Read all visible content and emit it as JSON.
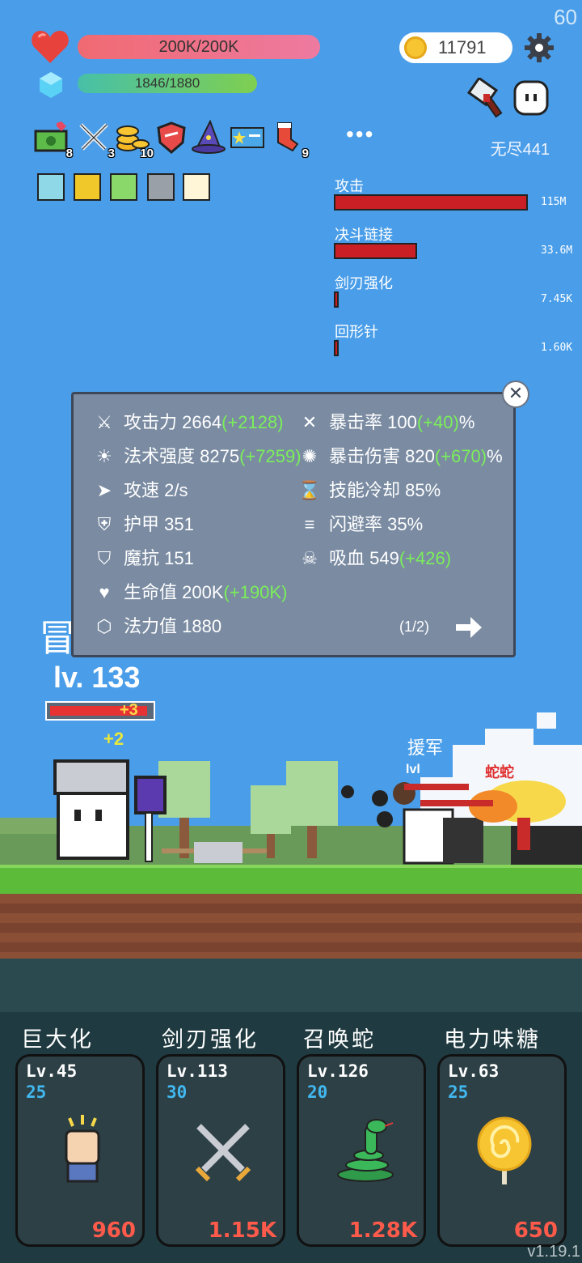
{
  "fps": "60",
  "hp": {
    "text": "200K/200K"
  },
  "mp": {
    "text": "1846/1880",
    "fraction": 0.982
  },
  "coins": "11791",
  "endless": "无尽441",
  "items": [
    {
      "name": "money",
      "count": "8"
    },
    {
      "name": "swords",
      "count": "3"
    },
    {
      "name": "coins",
      "count": "10"
    },
    {
      "name": "shield",
      "count": ""
    },
    {
      "name": "wizard-hat",
      "count": ""
    },
    {
      "name": "card",
      "count": ""
    },
    {
      "name": "sock",
      "count": "9"
    }
  ],
  "more": "•••",
  "buffs": [
    "bulb",
    "monster",
    "check",
    "blade",
    "burst"
  ],
  "damage": [
    {
      "label": "攻击",
      "value": "115M",
      "fraction": 1.0
    },
    {
      "label": "决斗链接",
      "value": "33.6M",
      "fraction": 0.43
    },
    {
      "label": "剑刃强化",
      "value": "7.45K",
      "fraction": 0.02
    },
    {
      "label": "回形针",
      "value": "1.60K",
      "fraction": 0.02
    }
  ],
  "stats": {
    "atk": {
      "label": "攻击力",
      "value": "2664",
      "bonus": "(+2128)"
    },
    "crit": {
      "label": "暴击率",
      "value": "100",
      "bonus": "(+40)",
      "unit": "%"
    },
    "spell": {
      "label": "法术强度",
      "value": "8275",
      "bonus": "(+7259)"
    },
    "critdmg": {
      "label": "暴击伤害",
      "value": "820",
      "bonus": "(+670)",
      "unit": "%"
    },
    "aspd": {
      "label": "攻速",
      "value": "2/s"
    },
    "cdr": {
      "label": "技能冷却",
      "value": "85%"
    },
    "armor": {
      "label": "护甲",
      "value": "351"
    },
    "dodge": {
      "label": "闪避率",
      "value": "35%"
    },
    "mr": {
      "label": "魔抗",
      "value": "151"
    },
    "lifesteal": {
      "label": "吸血",
      "value": "549",
      "bonus": "(+426)"
    },
    "hp": {
      "label": "生命值",
      "value": "200K",
      "bonus": "(+190K)"
    },
    "mp": {
      "label": "法力值",
      "value": "1880"
    },
    "page": "(1/2)"
  },
  "hero": {
    "level": "lv. 133",
    "gain": "+3",
    "float": "+2",
    "cut_text": "冒"
  },
  "enemies": {
    "name": "援军",
    "snake": "蛇蛇",
    "lv": "lvl"
  },
  "skills": [
    {
      "title": "巨大化",
      "lv": "Lv.45",
      "cost": "25",
      "price": "960",
      "icon": "fist-icon"
    },
    {
      "title": "剑刃强化",
      "lv": "Lv.113",
      "cost": "30",
      "price": "1.15K",
      "icon": "crossed-swords-icon"
    },
    {
      "title": "召唤蛇",
      "lv": "Lv.126",
      "cost": "20",
      "price": "1.28K",
      "icon": "snake-icon"
    },
    {
      "title": "电力味糖",
      "lv": "Lv.63",
      "cost": "25",
      "price": "650",
      "icon": "lollipop-icon"
    }
  ],
  "version": "v1.19.1"
}
